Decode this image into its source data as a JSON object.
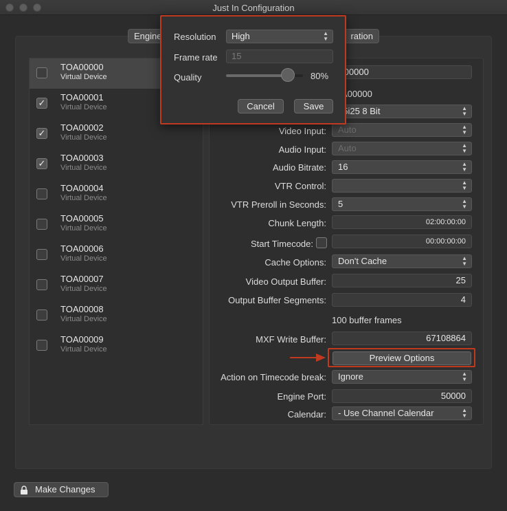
{
  "window": {
    "title": "Just In Configuration"
  },
  "tabs": [
    {
      "label": "Engine"
    },
    {
      "label": "ration"
    }
  ],
  "devices": [
    {
      "name": "TOA00000",
      "subtitle": "Virtual Device",
      "checked": false,
      "selected": true
    },
    {
      "name": "TOA00001",
      "subtitle": "Virtual Device",
      "checked": true,
      "selected": false
    },
    {
      "name": "TOA00002",
      "subtitle": "Virtual Device",
      "checked": true,
      "selected": false
    },
    {
      "name": "TOA00003",
      "subtitle": "Virtual Device",
      "checked": true,
      "selected": false
    },
    {
      "name": "TOA00004",
      "subtitle": "Virtual Device",
      "checked": false,
      "selected": false
    },
    {
      "name": "TOA00005",
      "subtitle": "Virtual Device",
      "checked": false,
      "selected": false
    },
    {
      "name": "TOA00006",
      "subtitle": "Virtual Device",
      "checked": false,
      "selected": false
    },
    {
      "name": "TOA00007",
      "subtitle": "Virtual Device",
      "checked": false,
      "selected": false
    },
    {
      "name": "TOA00008",
      "subtitle": "Virtual Device",
      "checked": false,
      "selected": false
    },
    {
      "name": "TOA00009",
      "subtitle": "Virtual Device",
      "checked": false,
      "selected": false
    }
  ],
  "config": {
    "name_value": "A00000",
    "id_value": "A00000",
    "format_value": "25i25 8 Bit",
    "video_input": {
      "label": "Video Input:",
      "value": "Auto"
    },
    "audio_input": {
      "label": "Audio Input:",
      "value": "Auto"
    },
    "audio_bitrate": {
      "label": "Audio Bitrate:",
      "value": "16"
    },
    "vtr_control": {
      "label": "VTR Control:",
      "value": ""
    },
    "vtr_preroll": {
      "label": "VTR Preroll in Seconds:",
      "value": "5"
    },
    "chunk_length": {
      "label": "Chunk Length:",
      "value": "02:00:00:00"
    },
    "start_timecode": {
      "label": "Start Timecode:",
      "value": "00:00:00:00"
    },
    "cache_options": {
      "label": "Cache Options:",
      "value": "Don't Cache"
    },
    "video_output_buffer": {
      "label": "Video Output Buffer:",
      "value": "25"
    },
    "output_buffer_segments": {
      "label": "Output Buffer Segments:",
      "value": "4"
    },
    "buffer_frames_text": "100 buffer frames",
    "mxf_write_buffer": {
      "label": "MXF Write Buffer:",
      "value": "67108864"
    },
    "preview_options_label": "Preview Options",
    "action_on_timecode_break": {
      "label": "Action on Timecode break:",
      "value": "Ignore"
    },
    "engine_port": {
      "label": "Engine Port:",
      "value": "50000"
    },
    "calendar": {
      "label": "Calendar:",
      "value": "- Use Channel Calendar"
    }
  },
  "make_changes_label": "Make Changes",
  "popover": {
    "resolution": {
      "label": "Resolution",
      "value": "High"
    },
    "frame_rate": {
      "label": "Frame rate",
      "placeholder": "15"
    },
    "quality": {
      "label": "Quality",
      "value_text": "80%",
      "level": 0.8
    },
    "cancel_label": "Cancel",
    "save_label": "Save"
  },
  "colors": {
    "highlight": "#c03a20",
    "background": "#2c2c2c"
  },
  "icons": {
    "lock": "lock-icon",
    "arrow": "arrow-right-icon",
    "stepper": "updown-icon"
  }
}
